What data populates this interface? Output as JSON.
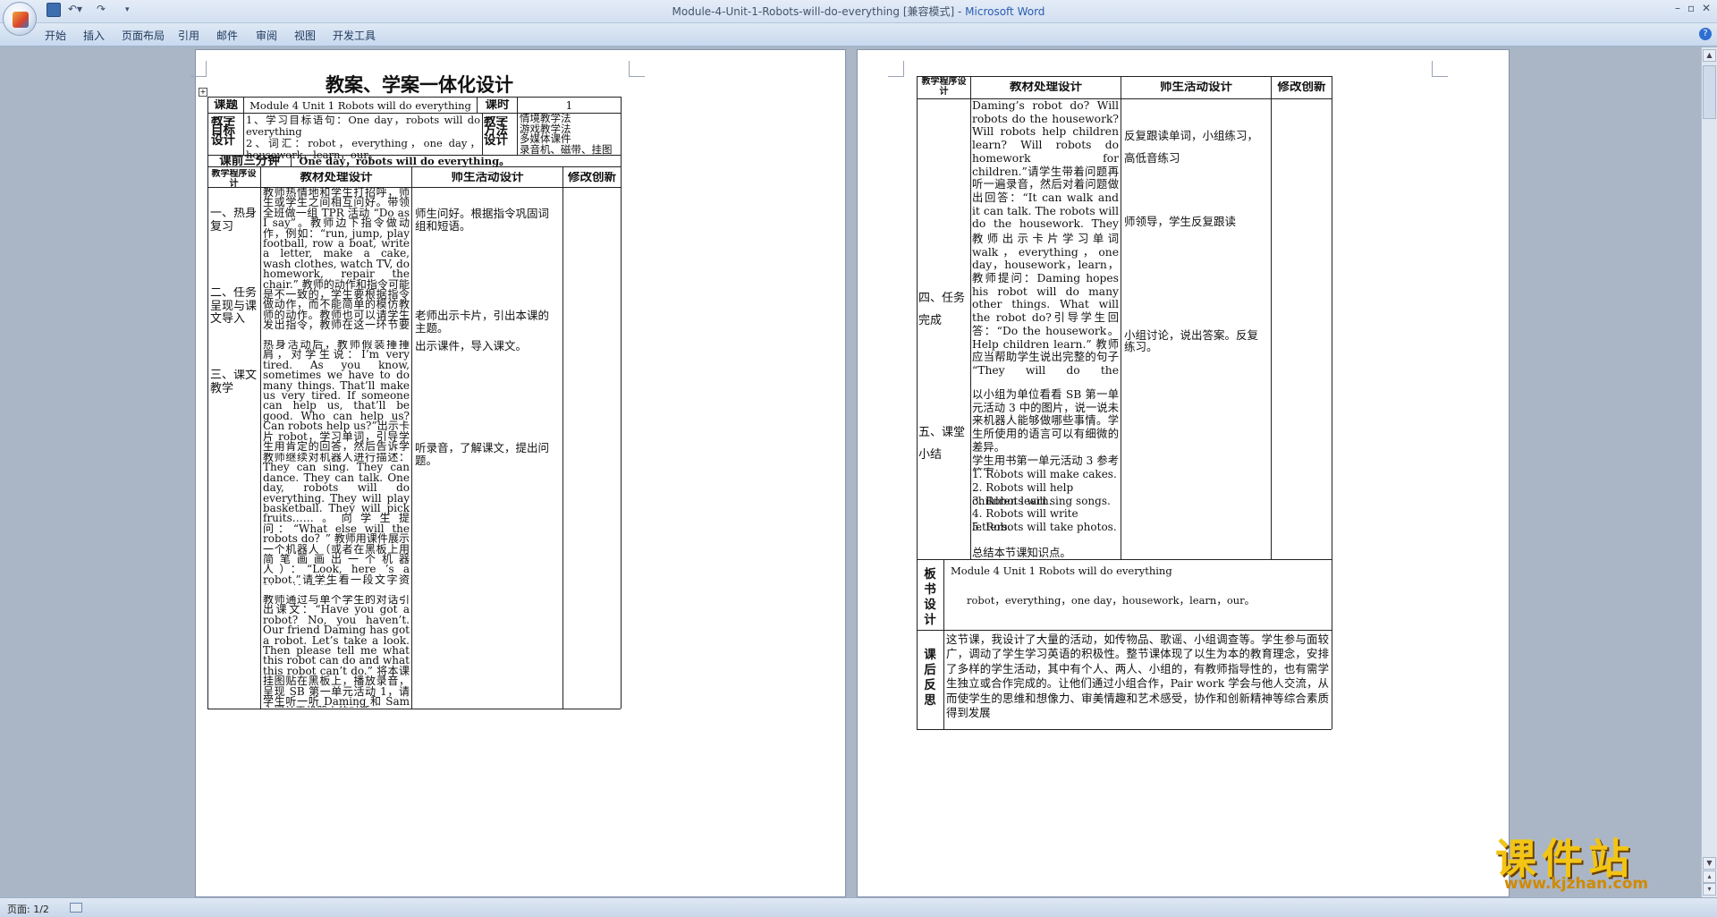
{
  "window": {
    "title": "Module-4-Unit-1-Robots-will-do-everything [兼容模式] - ",
    "app": "Microsoft Word"
  },
  "ribbon": {
    "tabs": [
      "开始",
      "插入",
      "页面布局",
      "引用",
      "邮件",
      "审阅",
      "视图",
      "开发工具"
    ]
  },
  "page1": {
    "title": "教案、学案一体化设计",
    "header": {
      "label_topic": "课题",
      "topic": "Module 4 Unit 1 Robots will do everything",
      "label_hours": "课时",
      "hours": "1",
      "label_goals": "教学目标设计",
      "goals": "1、学习目标语句：One day，robots will do everything\n2、词汇：robot，everything，one day，housework，learn，our。",
      "label_methods": "教学方法设计",
      "methods": "情境教学法\n游戏教学法\n多媒体课件\n录音机、磁带、挂图",
      "label_warmup": "课前三分钟",
      "warmup": "One day，robots will do everything。"
    },
    "columns": [
      "教学程序设计",
      "教材处理设计",
      "师生活动设计",
      "修改创新"
    ],
    "steps": [
      "一、热身复习",
      "二、任务呈现与课文导入",
      "三、课文教学"
    ],
    "material": [
      "教师热情地和学生打招呼，师生或学生之间相互问好。带领全班做一组 TPR 活动 “Do as I say”。教师边下指令做动作，例如：“run, jump, play football, row a boat, write a letter, make a cake, wash clothes, watch TV, do homework, repair the chair.” 教师的动作和指令可能是不一致的，学生要根据指令做动作，而不能简单的模仿教师的动作。教师也可以请学生发出指令，教师在这一环节要有意识地多练习学过的动词和动词词组，为后面的教学做铺垫。",
      "热身活动后，教师假装捶捶肩，对学生说：I’m very tired. As you know, sometimes we have to do many things. That’ll make us very tired. If someone can help us, that’ll be good. Who can help us? Can robots help us?”出示卡片 robot，学习单词，引导学生用肯定的回答，然后告诉学生：Today, we’re going to talk about the robots。",
      "教师继续对机器人进行描述：They can sing. They can dance. They can talk. One day, robots will do everything. They will play basketball. They will pick fruits……。向学生提问：“What else will the robots do？” 教师用课件展示一个机器人（或者在黑板上用简笔画画出一个机器人）：“Look, here ’s a robot.”请学生看一段文字资料，然后问：“What will they do?”，教师可以引导学生先学习今天的课文。",
      "教师通过与单个学生的对话引出课文：“Have you got a robot? No, you haven’t. Our friend Daming has got a robot. Let’s take a look. Then please tell me what this robot can do and what this robot can’t do.” 将本课挂图贴在黑板上，播放录音，呈现 SB 第一单元活动 1，请学生听一听 Daming 和 Sam 之间关于机器人的对话。\n教师提出问题：“What can"
    ],
    "activity": [
      "师生问好。根据指令巩固词组和短语。",
      "老师出示卡片，引出本课的主题。",
      "出示课件，导入课文。",
      "听录音，了解课文，提出问题。"
    ]
  },
  "page2": {
    "columns": [
      "教学程序设计",
      "教材处理设计",
      "师生活动设计",
      "修改创新"
    ],
    "steps": [
      "四、任务完成",
      "五、课堂小结"
    ],
    "material": [
      "Daming’s robot do? Will robots do the housework? Will robots help children learn? Will robots do homework for children.”请学生带着问题再听一遍录音，然后对着问题做出回答：“It can walk and it can talk. The robots will do the housework. They will help children learn. But they won’t do homework for children.”",
      "教师出示卡片学习单词 walk，everything，one day，housework，learn，our。",
      "教师提问：Daming hopes his robot will do many other things. What will the robot do?引导学生回答：“Do the housework。 Help children learn.” 教师应当帮助学生说出完整的句子 “They will do the housework. They will help children learn.”",
      "以小组为单位看看 SB 第一单元活动 3 中的图片，说一说未来机器人能够做哪些事情。学生所使用的语言可以有细微的差异。\n学生用书第一单元活动 3 参考答案：",
      "总结本节课知识点。"
    ],
    "answers": [
      "1. Robots will make cakes.",
      "2. Robots will help children learn.",
      "3. Robots will sing songs.",
      "4. Robots will write letters.",
      "5. Robots will take photos."
    ],
    "activity": [
      "反复跟读单词，小组练习，高低音练习",
      "师领导，学生反复跟读",
      "小组讨论，说出答案。反复练习。"
    ],
    "board_label": "板书设计",
    "board": [
      "Module 4 Unit 1 Robots will do everything",
      "robot，everything，one day，housework，learn，our。"
    ],
    "reflection_label": "课后反思",
    "reflection": "这节课，我设计了大量的活动，如传物品、歌谣、小组调查等。学生参与面较广，调动了学生学习英语的积极性。整节课体现了以生为本的教育理念，安排了多样的学生活动，其中有个人、两人、小组的，有教师指导性的，也有需学生独立或合作完成的。让他们通过小组合作，Pair work 学会与他人交流，从而使学生的思维和想像力、审美情趣和艺术感受，协作和创新精神等综合素质得到发展"
  },
  "status": {
    "page": "页面: 1/2"
  },
  "watermark": {
    "cn": "课件站",
    "url": "www.kjzhan.com"
  }
}
